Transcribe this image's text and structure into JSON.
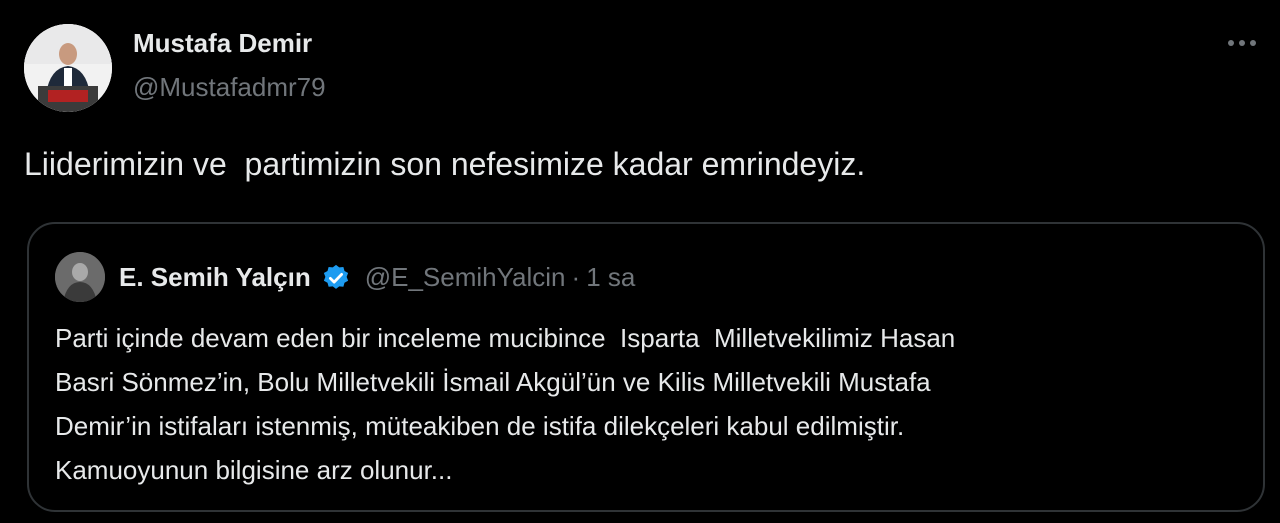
{
  "author": {
    "name": "Mustafa Demir",
    "handle": "@Mustafadmr79",
    "avatar": "avatar"
  },
  "more_icon": "more-horizontal-icon",
  "tweet_text": "Liiderimizin ve  partimizin son nefesimize kadar emrindeyiz.",
  "quoted": {
    "name": "E. Semih Yalçın",
    "verified_icon": "verified-badge-icon",
    "verified_color": "#1d9bf0",
    "handle": "@E_SemihYalcin",
    "separator": "·",
    "time": "1 sa",
    "lines": [
      "Parti içinde devam eden bir inceleme mucibince  Isparta  Milletvekilimiz Hasan",
      "Basri Sönmez’in, Bolu Milletvekili İsmail Akgül’ün ve Kilis Milletvekili Mustafa",
      "Demir’in istifaları istenmiş, müteakiben de istifa dilekçeleri kabul edilmiştir.",
      "Kamuoyunun bilgisine arz olunur..."
    ]
  },
  "colors": {
    "background": "#000000",
    "text": "#e7e9ea",
    "secondary": "#71767b",
    "border": "#2f3336"
  }
}
